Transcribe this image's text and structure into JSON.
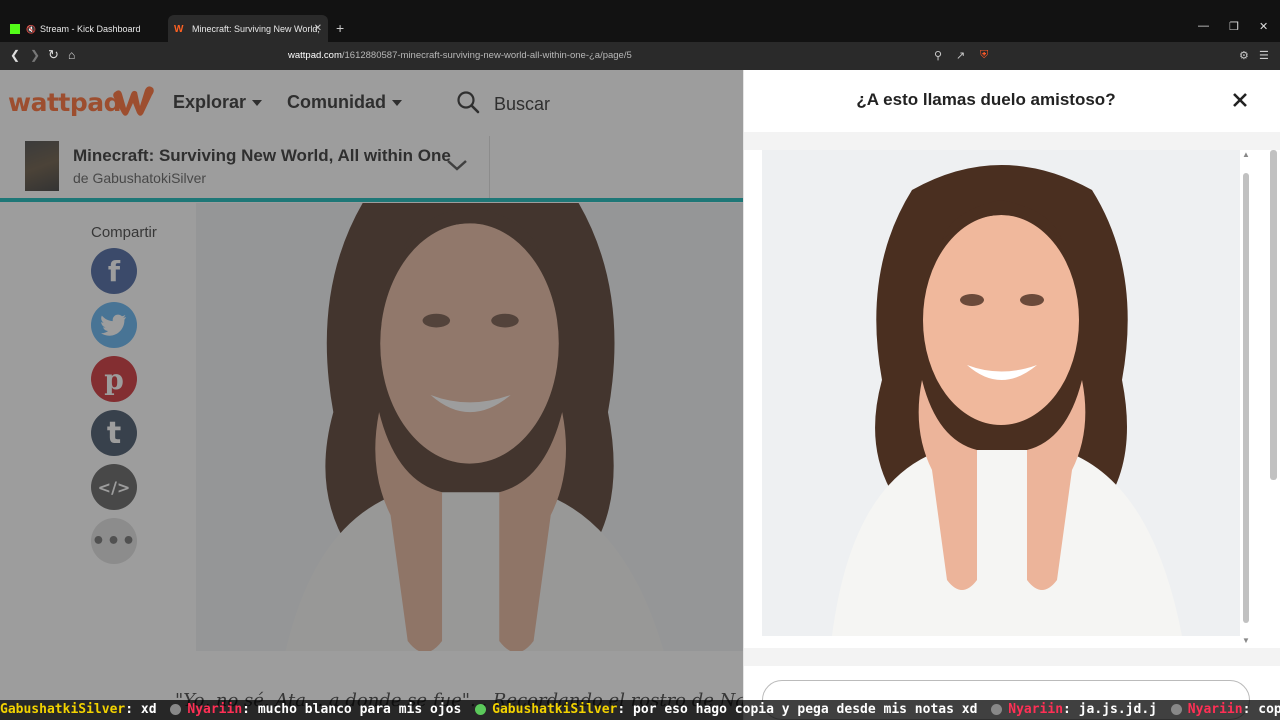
{
  "browser": {
    "tabs": [
      {
        "title": "Stream - Kick Dashboard",
        "favicon": "kick-icon",
        "active": false
      },
      {
        "title": "Minecraft: Surviving New World,",
        "favicon": "wattpad-icon",
        "active": true
      }
    ],
    "url_domain": "wattpad.com",
    "url_path": "/1612880587-minecraft-surviving-new-world-all-within-one-¿a/page/5"
  },
  "header": {
    "logo_text": "wattpad",
    "nav": [
      "Explorar",
      "Comunidad"
    ],
    "search_label": "Buscar"
  },
  "story": {
    "title": "Minecraft: Surviving New World, All within One",
    "author": "de GabushatokiSilver"
  },
  "share": {
    "label": "Compartir",
    "networks": [
      "facebook",
      "twitter",
      "pinterest",
      "tumblr",
      "embed",
      "more"
    ]
  },
  "body_text": "\"Yo, no sé. Ata... a donde se fue\"... Recordando el rostro de Naruto",
  "panel": {
    "title": "¿A esto llamas duelo amistoso?"
  },
  "chat": [
    {
      "user": "GabushatkiSilver",
      "text": ": xd",
      "color": "#f2d200"
    },
    {
      "user": "Nyariin",
      "text": ": mucho blanco para mis ojos",
      "color": "#ff2f55"
    },
    {
      "user": "GabushatkiSilver",
      "text": ": por eso hago copia y pega desde mis notas xd",
      "color": "#f2d200"
    },
    {
      "user": "Nyariin",
      "text": ": ja.js.jd.j",
      "color": "#ff2f55"
    },
    {
      "user": "Nyariin",
      "text": ": copiapega",
      "color": "#ff2f55"
    }
  ]
}
